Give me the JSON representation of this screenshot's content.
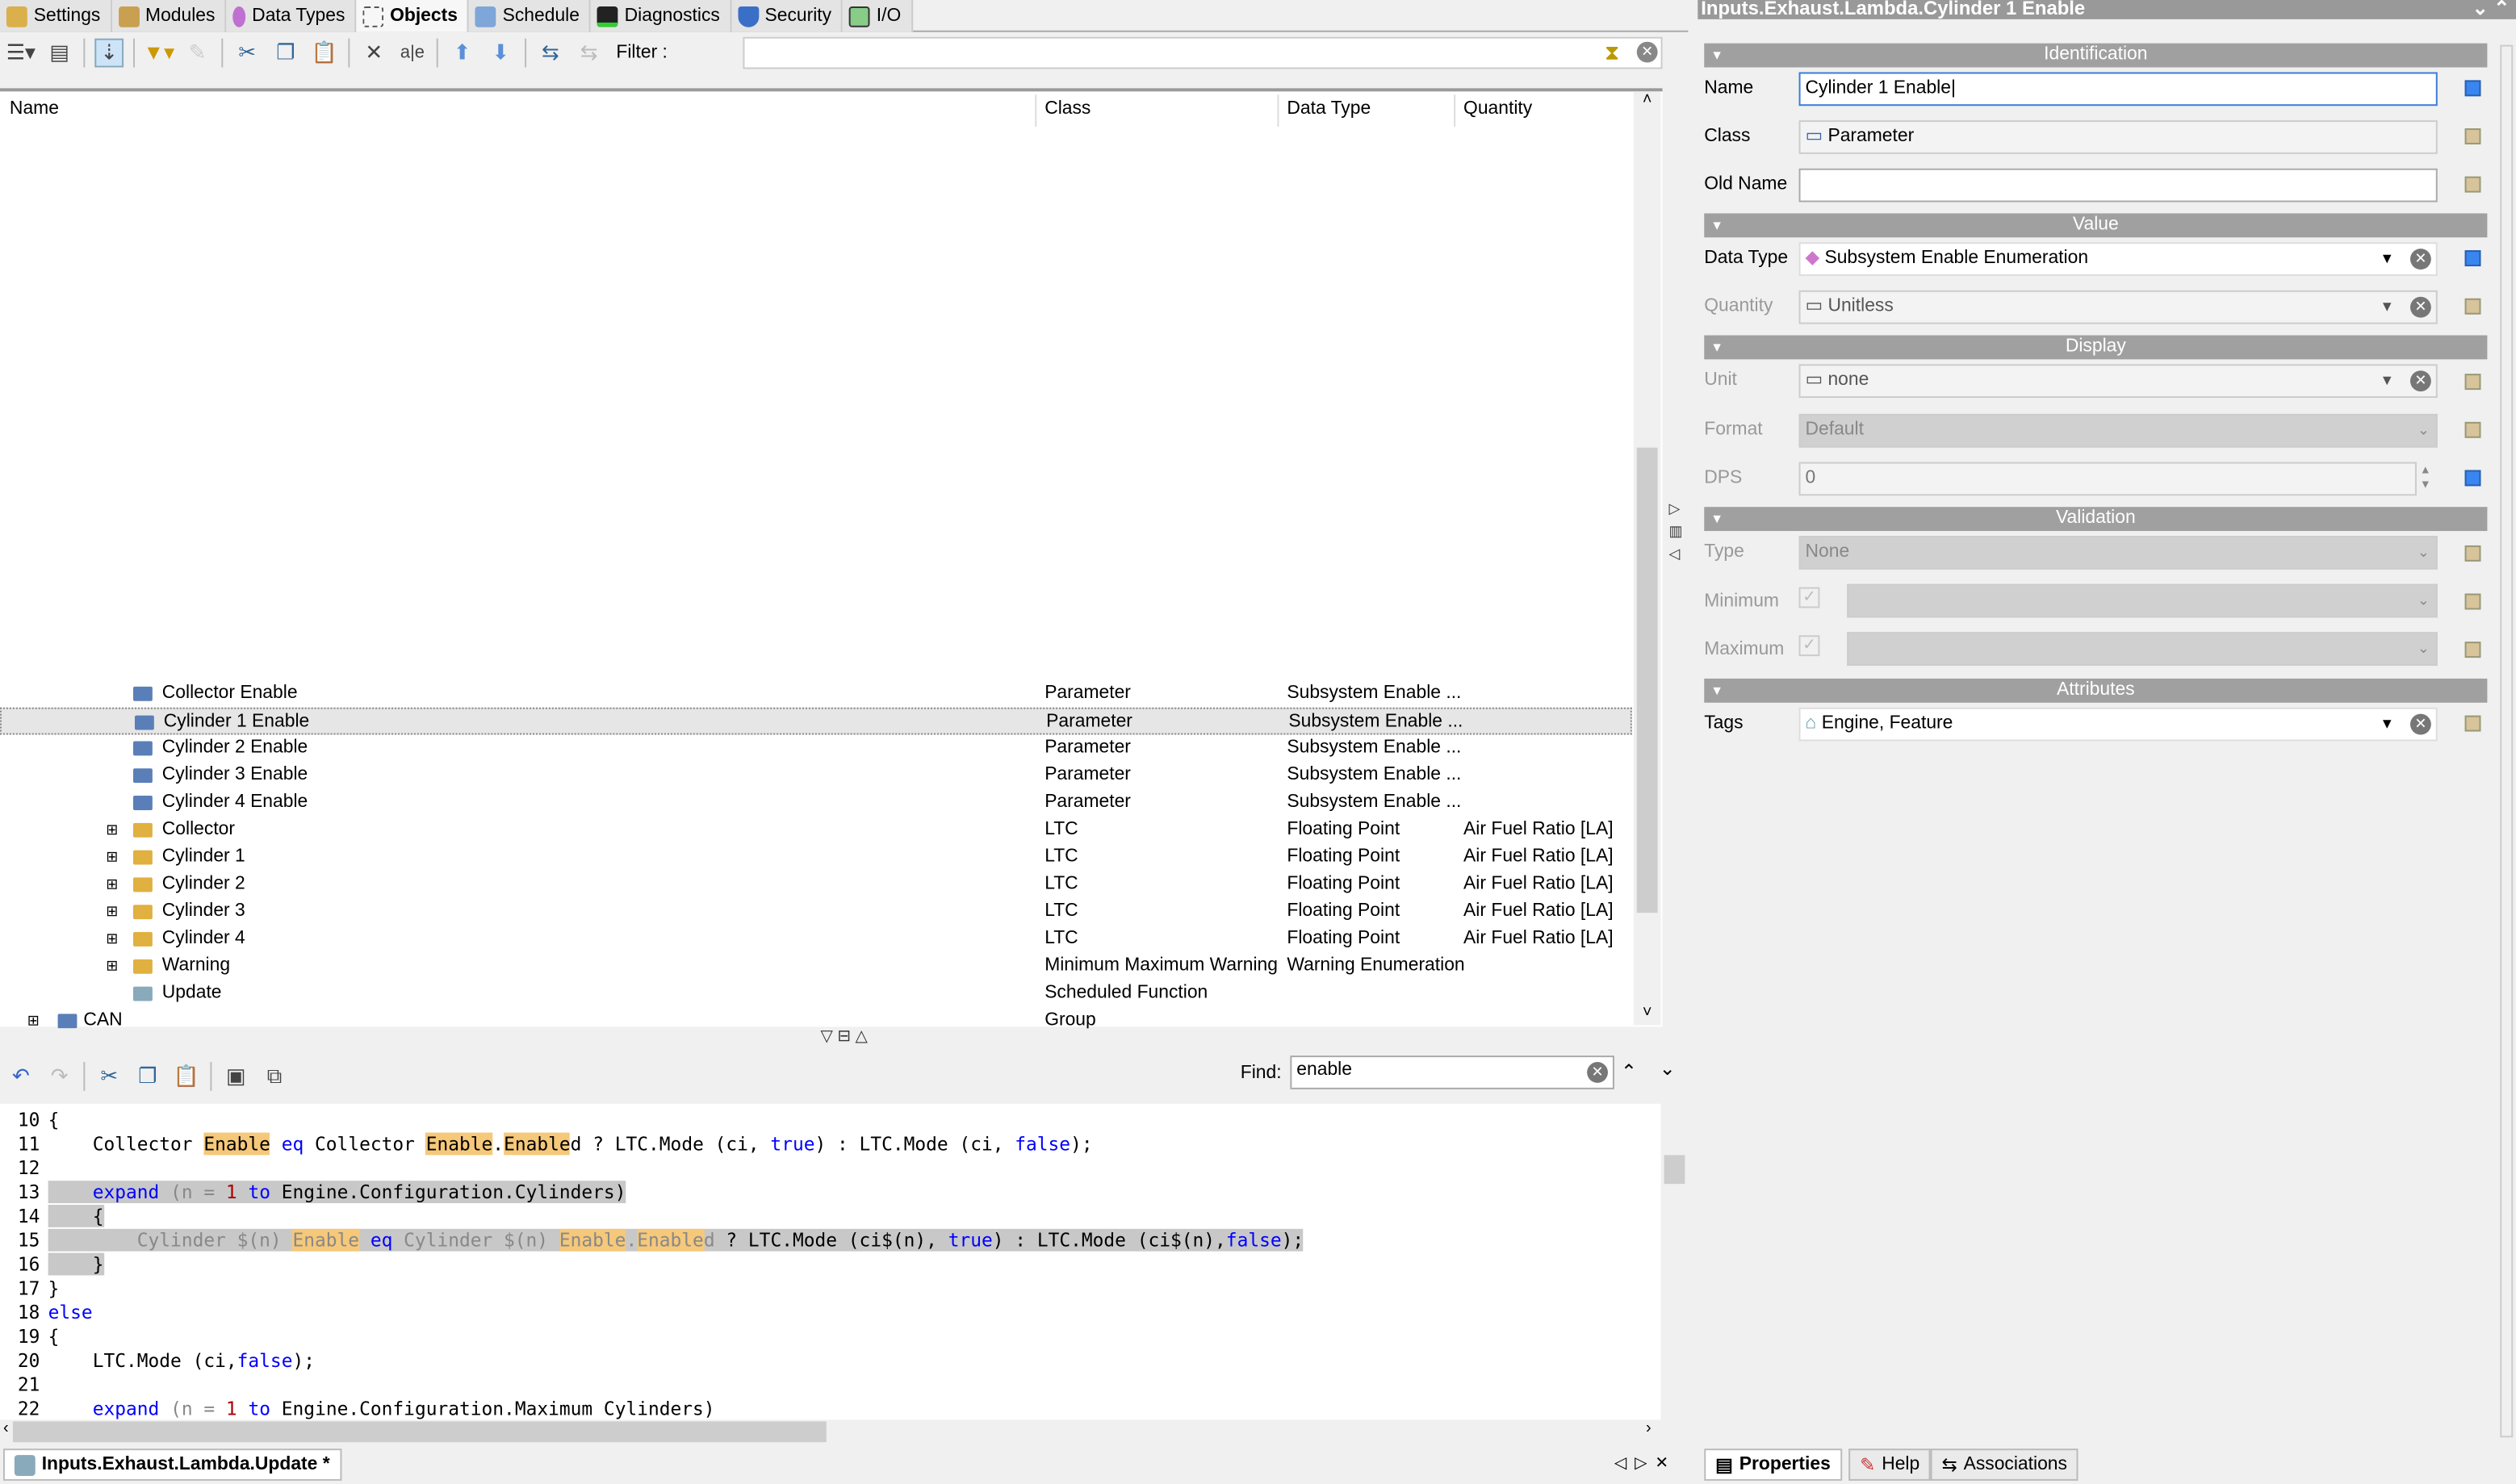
{
  "tabs": [
    {
      "label": "Settings"
    },
    {
      "label": "Modules"
    },
    {
      "label": "Data Types"
    },
    {
      "label": "Objects",
      "active": true
    },
    {
      "label": "Schedule"
    },
    {
      "label": "Diagnostics"
    },
    {
      "label": "Security"
    },
    {
      "label": "I/O"
    }
  ],
  "toolbar": {
    "filter_label": "Filter :",
    "filter_value": ""
  },
  "tree": {
    "columns": [
      "Name",
      "Class",
      "Data Type",
      "Quantity"
    ],
    "rows": [
      {
        "name": "Collector Enable",
        "class": "Parameter",
        "type": "Subsystem Enable ...",
        "qty": ""
      },
      {
        "name": "Cylinder 1 Enable",
        "class": "Parameter",
        "type": "Subsystem Enable ...",
        "qty": "",
        "selected": true
      },
      {
        "name": "Cylinder 2 Enable",
        "class": "Parameter",
        "type": "Subsystem Enable ...",
        "qty": ""
      },
      {
        "name": "Cylinder 3 Enable",
        "class": "Parameter",
        "type": "Subsystem Enable ...",
        "qty": ""
      },
      {
        "name": "Cylinder 4 Enable",
        "class": "Parameter",
        "type": "Subsystem Enable ...",
        "qty": ""
      },
      {
        "name": "Collector",
        "class": "LTC",
        "type": "Floating Point",
        "qty": "Air Fuel Ratio [LA]",
        "expand": true
      },
      {
        "name": "Cylinder 1",
        "class": "LTC",
        "type": "Floating Point",
        "qty": "Air Fuel Ratio [LA]",
        "expand": true
      },
      {
        "name": "Cylinder 2",
        "class": "LTC",
        "type": "Floating Point",
        "qty": "Air Fuel Ratio [LA]",
        "expand": true
      },
      {
        "name": "Cylinder 3",
        "class": "LTC",
        "type": "Floating Point",
        "qty": "Air Fuel Ratio [LA]",
        "expand": true
      },
      {
        "name": "Cylinder 4",
        "class": "LTC",
        "type": "Floating Point",
        "qty": "Air Fuel Ratio [LA]",
        "expand": true
      },
      {
        "name": "Warning",
        "class": "Minimum Maximum Warning",
        "type": "Warning Enumeration",
        "qty": "",
        "expand": true
      },
      {
        "name": "Update",
        "class": "Scheduled Function",
        "type": "",
        "qty": ""
      },
      {
        "name": "CAN",
        "class": "Group",
        "type": "",
        "qty": "",
        "expand": true,
        "top": true
      }
    ]
  },
  "editor": {
    "find_label": "Find:",
    "find_value": "enable",
    "lines": [
      "10",
      "11",
      "12",
      "13",
      "14",
      "15",
      "16",
      "17",
      "18",
      "19",
      "20",
      "21",
      "22"
    ],
    "code": {
      "l10": "{",
      "l11a": "    Collector ",
      "l11b": "Enable",
      "l11c": " eq ",
      "l11d": "Collector ",
      "l11e": "Enable",
      "l11f": ".",
      "l11g": "Enable",
      "l11h": "d ? LTC.Mode (ci, ",
      "l11i": "true",
      "l11j": ") : LTC.Mode (ci, ",
      "l11k": "false",
      "l11l": ");",
      "l13a": "expand",
      "l13b": " (n = ",
      "l13c": "1",
      "l13d": " to",
      "l13e": " Engine.Configuration.Cylinders)",
      "l14": "{",
      "l15a": "Cylinder $(n) ",
      "l15b": "Enable",
      "l15c": " eq ",
      "l15d": "Cylinder $(n) ",
      "l15e": "Enable",
      "l15f": ".",
      "l15g": "Enable",
      "l15h": "d",
      " l15i": "",
      "l15j": " ? LTC.Mode (ci$(n), ",
      "l15k": "true",
      "l15l": ") : LTC.Mode (ci$(n),",
      "l15m": "false",
      "l15n": ");",
      "l16": "}",
      "l17": "}",
      "l18": "else",
      "l19": "{",
      "l20a": "    LTC.Mode (ci,",
      "l20b": "false",
      "l20c": ");",
      "l22a": "expand",
      "l22b": " (n = ",
      "l22c": "1",
      "l22d": " to",
      "l22e": " Engine.Configuration.Maximum Cylinders)"
    },
    "doc_tab": "Inputs.Exhaust.Lambda.Update *"
  },
  "props": {
    "title": "Inputs.Exhaust.Lambda.Cylinder 1 Enable",
    "sections": {
      "identification": "Identification",
      "value": "Value",
      "display": "Display",
      "validation": "Validation",
      "attributes": "Attributes"
    },
    "labels": {
      "name": "Name",
      "class": "Class",
      "old_name": "Old Name",
      "data_type": "Data Type",
      "quantity": "Quantity",
      "unit": "Unit",
      "format": "Format",
      "dps": "DPS",
      "type": "Type",
      "minimum": "Minimum",
      "maximum": "Maximum",
      "tags": "Tags"
    },
    "values": {
      "name": "Cylinder 1 Enable",
      "class": "Parameter",
      "old_name": "",
      "data_type": "Subsystem Enable Enumeration",
      "quantity": "Unitless",
      "unit": "none",
      "format": "Default",
      "dps": "0",
      "type": "None",
      "tags": "Engine, Feature"
    },
    "bottom_tabs": [
      {
        "label": "Properties"
      },
      {
        "label": "Help"
      },
      {
        "label": "Associations"
      }
    ]
  }
}
